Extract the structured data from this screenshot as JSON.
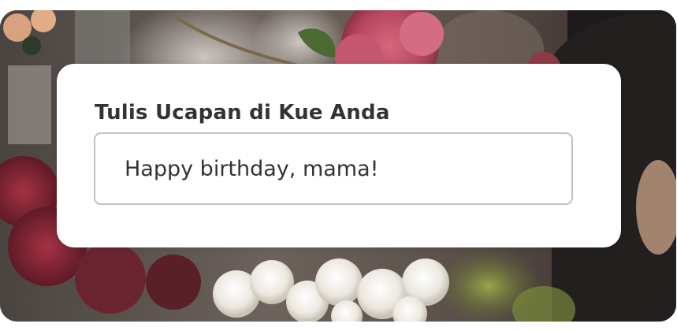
{
  "card": {
    "title": "Tulis Ucapan di Kue Anda",
    "message_input": {
      "value": "Happy birthday, mama!"
    }
  },
  "background": {
    "description_icon": "flower-photo"
  }
}
